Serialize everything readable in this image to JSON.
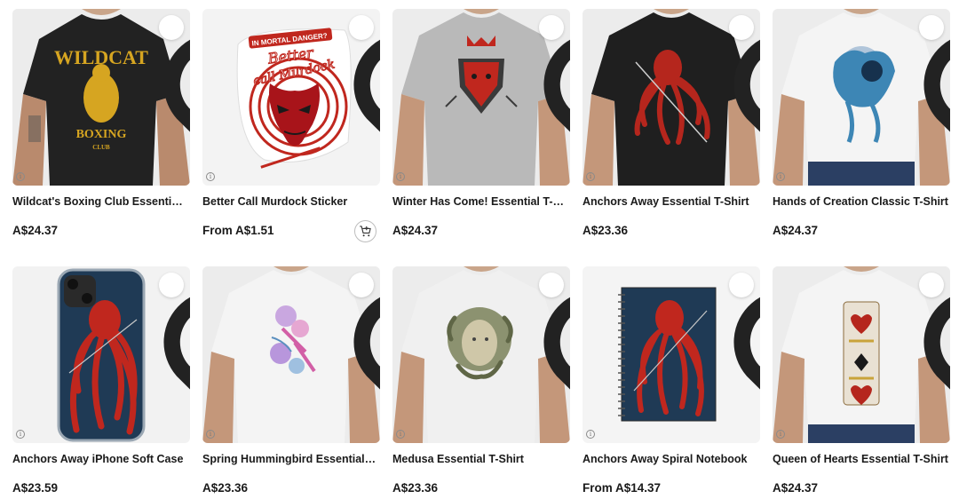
{
  "colors": {
    "text": "#1a1a1a",
    "card_bg": "#f2f2f2",
    "accent_red": "#c0271e",
    "navy": "#1f3a55"
  },
  "products": [
    {
      "title": "Wildcat's Boxing Club Essential ...",
      "price": "A$24.37",
      "image": "black-tshirt-wildcat-boxing",
      "has_cart": false
    },
    {
      "title": "Better Call Murdock Sticker",
      "price": "From A$1.51",
      "image": "red-devil-sticker",
      "has_cart": true
    },
    {
      "title": "Winter Has Come! Essential T-S...",
      "price": "A$24.37",
      "image": "grey-tshirt-red-wolf",
      "has_cart": false
    },
    {
      "title": "Anchors Away Essential T-Shirt",
      "price": "A$23.36",
      "image": "black-tshirt-red-octopus",
      "has_cart": false
    },
    {
      "title": "Hands of Creation Classic T-Shirt",
      "price": "A$24.37",
      "image": "white-tshirt-blue-creature",
      "has_cart": false
    },
    {
      "title": "Anchors Away iPhone Soft Case",
      "price": "A$23.59",
      "image": "iphone-case-red-octopus",
      "has_cart": false
    },
    {
      "title": "Spring Hummingbird Essential T...",
      "price": "A$23.36",
      "image": "white-tshirt-hummingbird",
      "has_cart": false
    },
    {
      "title": "Medusa Essential T-Shirt",
      "price": "A$23.36",
      "image": "white-tshirt-medusa",
      "has_cart": false
    },
    {
      "title": "Anchors Away Spiral Notebook",
      "price": "From A$14.37",
      "image": "spiral-notebook-red-octopus",
      "has_cart": false
    },
    {
      "title": "Queen of Hearts Essential T-Shirt",
      "price": "A$24.37",
      "image": "white-tshirt-queen-of-hearts",
      "has_cart": false
    }
  ],
  "icons": {
    "favorite": "heart-outline-icon",
    "info": "info-icon",
    "cart": "add-to-cart-icon"
  },
  "artwork_text": {
    "wildcat_top": "WILDCAT",
    "wildcat_mid": "BOXING",
    "wildcat_bottom": "CLUB",
    "sticker_banner": "IN MORTAL DANGER?",
    "sticker_script_1": "Better",
    "sticker_script_2": "call Murdock",
    "info_glyph": "i"
  }
}
